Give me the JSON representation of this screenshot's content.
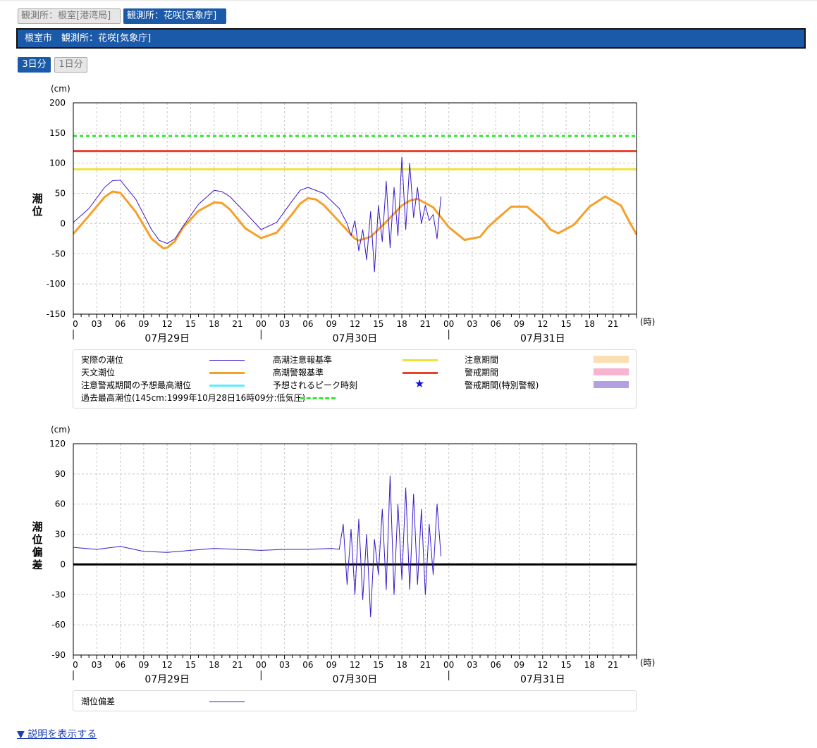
{
  "tabs": [
    {
      "label": "観測所：根室[港湾局]",
      "active": false
    },
    {
      "label": "観測所：花咲[気象庁]",
      "active": true
    }
  ],
  "header": {
    "title": "根室市　観測所：花咲[気象庁]"
  },
  "range_buttons": [
    {
      "label": "3日分",
      "active": true
    },
    {
      "label": "1日分",
      "active": false
    }
  ],
  "x_axis": {
    "hour_ticks": [
      "0",
      "03",
      "06",
      "09",
      "12",
      "15",
      "18",
      "21",
      "00",
      "03",
      "06",
      "09",
      "12",
      "15",
      "18",
      "21",
      "00",
      "03",
      "06",
      "09",
      "12",
      "15",
      "18",
      "21"
    ],
    "unit": "(時)",
    "dates": [
      "07月29日",
      "07月30日",
      "07月31日"
    ]
  },
  "legend_top": {
    "actual": "実際の潮位",
    "astro": "天文潮位",
    "forecast_max": "注意警戒期間の予想最高潮位",
    "historic": "過去最高潮位(145cm:1999年10月28日16時09分:低気圧)",
    "caution_std": "高潮注意報基準",
    "warning_std": "高潮警報基準",
    "peak": "予想されるピーク時刻",
    "caution_period": "注意期間",
    "warning_period": "警戒期間",
    "special_period": "警戒期間(特別警報)",
    "peak_icon": "star-icon",
    "peak_symbol": "★"
  },
  "legend_bottom": {
    "deviation": "潮位偏差"
  },
  "colors": {
    "actual": "#3a18c8",
    "astro": "#f5a02a",
    "caution": "#f0e13a",
    "warning": "#e8402a",
    "historic": "#33e533",
    "forecast": "#55f0ff",
    "caution_period": "#fbdfb3",
    "warning_period": "#f7b3cf",
    "special_period": "#b3a0e0",
    "peak": "#1010e0",
    "accent": "#1b5aa8",
    "link": "#1b3fb8"
  },
  "explain_link": "▼ 説明を表示する",
  "chart_data": [
    {
      "type": "line",
      "x_unit": "hour offset from 07月29日 00時",
      "xlim": [
        0,
        72
      ],
      "ylabel": "潮位",
      "unit": "(cm)",
      "ylim": [
        -150,
        200
      ],
      "yticks": [
        200,
        150,
        100,
        50,
        0,
        -50,
        -100,
        -150
      ],
      "grid": true,
      "reference_lines": [
        {
          "name": "過去最高潮位",
          "value": 145,
          "style": "dotted",
          "color": "#33e533"
        },
        {
          "name": "高潮警報基準",
          "value": 120,
          "color": "#e8402a"
        },
        {
          "name": "高潮注意報基準",
          "value": 90,
          "color": "#f0e13a"
        }
      ],
      "series": [
        {
          "name": "天文潮位",
          "x": [
            0,
            2,
            4,
            5,
            6,
            8,
            10,
            11.5,
            12,
            13,
            14,
            16,
            18,
            19,
            20,
            22,
            24,
            26,
            28,
            29,
            30,
            31,
            32,
            34,
            36,
            36.5,
            38,
            40,
            42,
            43,
            44,
            46,
            48,
            50,
            52,
            53,
            54,
            56,
            58,
            60,
            61,
            62,
            64,
            66,
            68,
            70,
            71,
            72
          ],
          "y": [
            -17,
            13,
            44,
            53,
            51,
            19,
            -25,
            -41,
            -40,
            -29,
            -7,
            21,
            35,
            34,
            24,
            -8,
            -24,
            -15,
            16,
            33,
            42,
            40,
            31,
            3,
            -25,
            -28,
            -22,
            3,
            30,
            38,
            41,
            27,
            -6,
            -27,
            -22,
            -6,
            6,
            28,
            28,
            6,
            -10,
            -16,
            -2,
            28,
            45,
            30,
            5,
            -18
          ]
        },
        {
          "name": "実際の潮位",
          "x": [
            0,
            2,
            4,
            5,
            6,
            8,
            10,
            11,
            12,
            13,
            14,
            16,
            18,
            19,
            20,
            22,
            24,
            26,
            28,
            29,
            30,
            32,
            34,
            35,
            35.5,
            36,
            36.5,
            37,
            37.5,
            38,
            38.5,
            39,
            39.5,
            40,
            40.5,
            41,
            41.5,
            42,
            42.5,
            43,
            43.5,
            44,
            44.5,
            45,
            45.5,
            46,
            46.5,
            47
          ],
          "y": [
            2,
            25,
            60,
            71,
            72,
            40,
            -10,
            -28,
            -33,
            -25,
            -5,
            32,
            55,
            53,
            45,
            18,
            -10,
            2,
            38,
            55,
            60,
            50,
            25,
            0,
            -20,
            5,
            -45,
            -10,
            -60,
            20,
            -80,
            30,
            -30,
            70,
            -40,
            60,
            -20,
            110,
            -10,
            100,
            10,
            60,
            0,
            30,
            5,
            15,
            -25,
            45
          ]
        }
      ]
    },
    {
      "type": "line",
      "x_unit": "hour offset from 07月29日 00時",
      "xlim": [
        0,
        72
      ],
      "ylabel": "潮位偏差",
      "unit": "(cm)",
      "ylim": [
        -90,
        120
      ],
      "yticks": [
        120,
        90,
        60,
        30,
        0,
        -30,
        -60,
        -90
      ],
      "grid": true,
      "reference_lines": [
        {
          "name": "zero",
          "value": 0,
          "color": "#000000"
        }
      ],
      "series": [
        {
          "name": "潮位偏差",
          "x": [
            0,
            3,
            6,
            9,
            12,
            15,
            18,
            21,
            24,
            27,
            30,
            33,
            34,
            34.5,
            35,
            35.5,
            36,
            36.5,
            37,
            37.5,
            38,
            38.5,
            39,
            39.5,
            40,
            40.5,
            41,
            41.5,
            42,
            42.5,
            43,
            43.5,
            44,
            44.5,
            45,
            45.5,
            46,
            46.5,
            47
          ],
          "y": [
            17,
            15,
            18,
            13,
            12,
            14,
            16,
            15,
            14,
            15,
            15,
            16,
            15,
            40,
            -20,
            35,
            -30,
            45,
            -35,
            30,
            -52,
            25,
            -10,
            55,
            -25,
            88,
            -30,
            60,
            -15,
            76,
            -25,
            70,
            -20,
            55,
            -30,
            40,
            -10,
            60,
            8
          ]
        }
      ]
    }
  ]
}
